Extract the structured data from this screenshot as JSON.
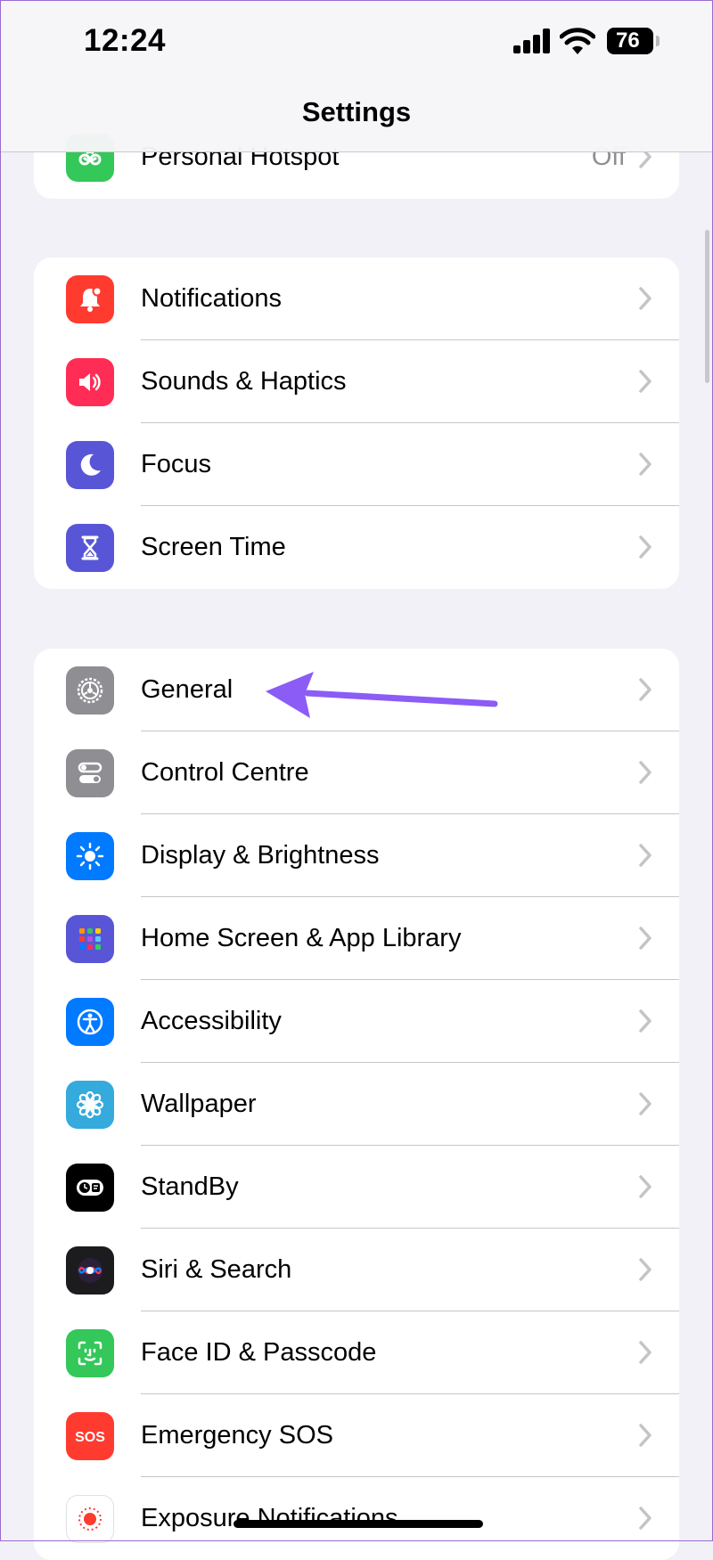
{
  "status_bar": {
    "time": "12:24",
    "battery": "76"
  },
  "nav": {
    "title": "Settings"
  },
  "groups": [
    {
      "items": [
        {
          "label": "Personal Hotspot",
          "value": "Off",
          "icon": "hotspot-icon",
          "color": "#34c759"
        }
      ]
    },
    {
      "items": [
        {
          "label": "Notifications",
          "icon": "bell-icon",
          "color": "#ff3b30"
        },
        {
          "label": "Sounds & Haptics",
          "icon": "speaker-icon",
          "color": "#ff2d55"
        },
        {
          "label": "Focus",
          "icon": "moon-icon",
          "color": "#5856d6"
        },
        {
          "label": "Screen Time",
          "icon": "hourglass-icon",
          "color": "#5856d6"
        }
      ]
    },
    {
      "items": [
        {
          "label": "General",
          "icon": "gear-icon",
          "color": "#8e8e93"
        },
        {
          "label": "Control Centre",
          "icon": "toggles-icon",
          "color": "#8e8e93"
        },
        {
          "label": "Display & Brightness",
          "icon": "sun-icon",
          "color": "#007aff"
        },
        {
          "label": "Home Screen & App Library",
          "icon": "app-grid-icon",
          "color": "#5856d6"
        },
        {
          "label": "Accessibility",
          "icon": "accessibility-icon",
          "color": "#007aff"
        },
        {
          "label": "Wallpaper",
          "icon": "flower-icon",
          "color": "#35aadc"
        },
        {
          "label": "StandBy",
          "icon": "standby-icon",
          "color": "#000000"
        },
        {
          "label": "Siri & Search",
          "icon": "siri-icon",
          "color": "#1c1c1e"
        },
        {
          "label": "Face ID & Passcode",
          "icon": "face-id-icon",
          "color": "#34c759"
        },
        {
          "label": "Emergency SOS",
          "icon": "sos-icon",
          "color": "#ff3b30"
        },
        {
          "label": "Exposure Notifications",
          "icon": "exposure-icon",
          "color": "#ffffff"
        }
      ]
    }
  ],
  "annotation": {
    "arrow_color": "#8b5cf6"
  }
}
